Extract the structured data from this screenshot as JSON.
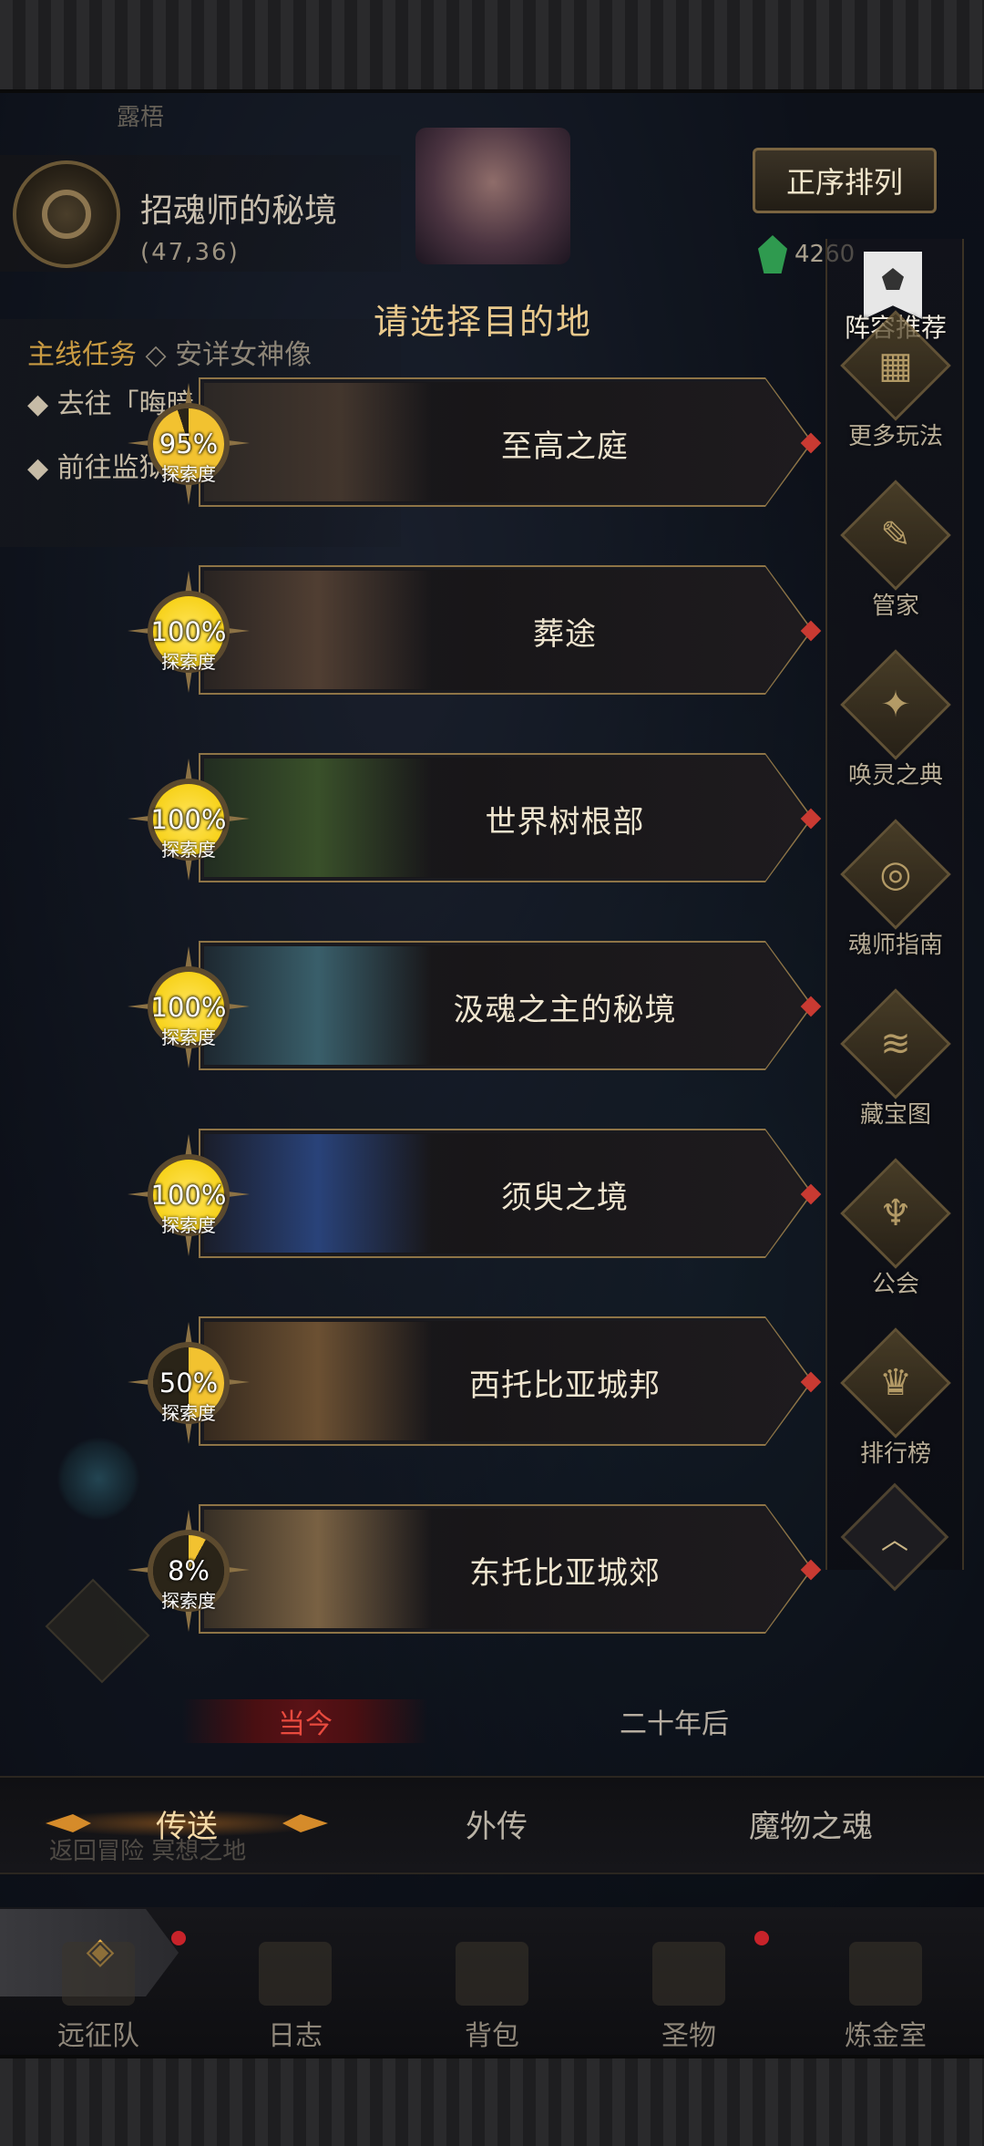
{
  "location": {
    "tab_label": "露梧",
    "name": "招魂师的秘境",
    "coords": "(47,36)"
  },
  "header": {
    "sort_button": "正序排列",
    "currency_value": "4260"
  },
  "quests": {
    "main_label": "主线任务",
    "main_sub": "◇ 安详女神像",
    "line2": "◆ 去往「晦暗」",
    "line3": "◆ 前往监狱外"
  },
  "title": "请选择目的地",
  "destinations": [
    {
      "name": "至高之庭",
      "progress": "95%",
      "progress_value": 95,
      "progress_label": "探索度"
    },
    {
      "name": "葬途",
      "progress": "100%",
      "progress_value": 100,
      "progress_label": "探索度"
    },
    {
      "name": "世界树根部",
      "progress": "100%",
      "progress_value": 100,
      "progress_label": "探索度"
    },
    {
      "name": "汲魂之主的秘境",
      "progress": "100%",
      "progress_value": 100,
      "progress_label": "探索度"
    },
    {
      "name": "须臾之境",
      "progress": "100%",
      "progress_value": 100,
      "progress_label": "探索度"
    },
    {
      "name": "西托比亚城邦",
      "progress": "50%",
      "progress_value": 50,
      "progress_label": "探索度"
    },
    {
      "name": "东托比亚城郊",
      "progress": "8%",
      "progress_value": 8,
      "progress_label": "探索度"
    }
  ],
  "sidebar": {
    "top_label": "阵容推荐",
    "items": [
      {
        "label": "更多玩法",
        "icon": "gift-icon",
        "glyph": "▦"
      },
      {
        "label": "管家",
        "icon": "quill-icon",
        "glyph": "✎"
      },
      {
        "label": "唤灵之典",
        "icon": "tome-icon",
        "glyph": "✦"
      },
      {
        "label": "魂师指南",
        "icon": "guide-icon",
        "glyph": "◎"
      },
      {
        "label": "藏宝图",
        "icon": "treasure-map-icon",
        "glyph": "≋"
      },
      {
        "label": "公会",
        "icon": "guild-icon",
        "glyph": "♆"
      },
      {
        "label": "排行榜",
        "icon": "trophy-icon",
        "glyph": "♛"
      }
    ],
    "collapse_glyph": "︿"
  },
  "era": {
    "now": "当今",
    "later": "二十年后"
  },
  "tabs": {
    "teleport": "传送",
    "side_story": "外传",
    "monster_soul": "魔物之魂"
  },
  "return_hint": "返回冒险 冥想之地",
  "nav": {
    "expand_glyph": "◈",
    "items": [
      {
        "label": "远征队",
        "icon": "expedition-icon"
      },
      {
        "label": "日志",
        "icon": "journal-icon"
      },
      {
        "label": "背包",
        "icon": "backpack-icon"
      },
      {
        "label": "圣物",
        "icon": "relic-icon"
      },
      {
        "label": "炼金室",
        "icon": "alchemy-icon"
      }
    ]
  },
  "colors": {
    "accent_gold": "#e9c98c",
    "progress_full": "#f7d21b",
    "progress_partial": "#f2c230",
    "era_active": "#e84a3e",
    "notification_red": "#c8232a"
  }
}
